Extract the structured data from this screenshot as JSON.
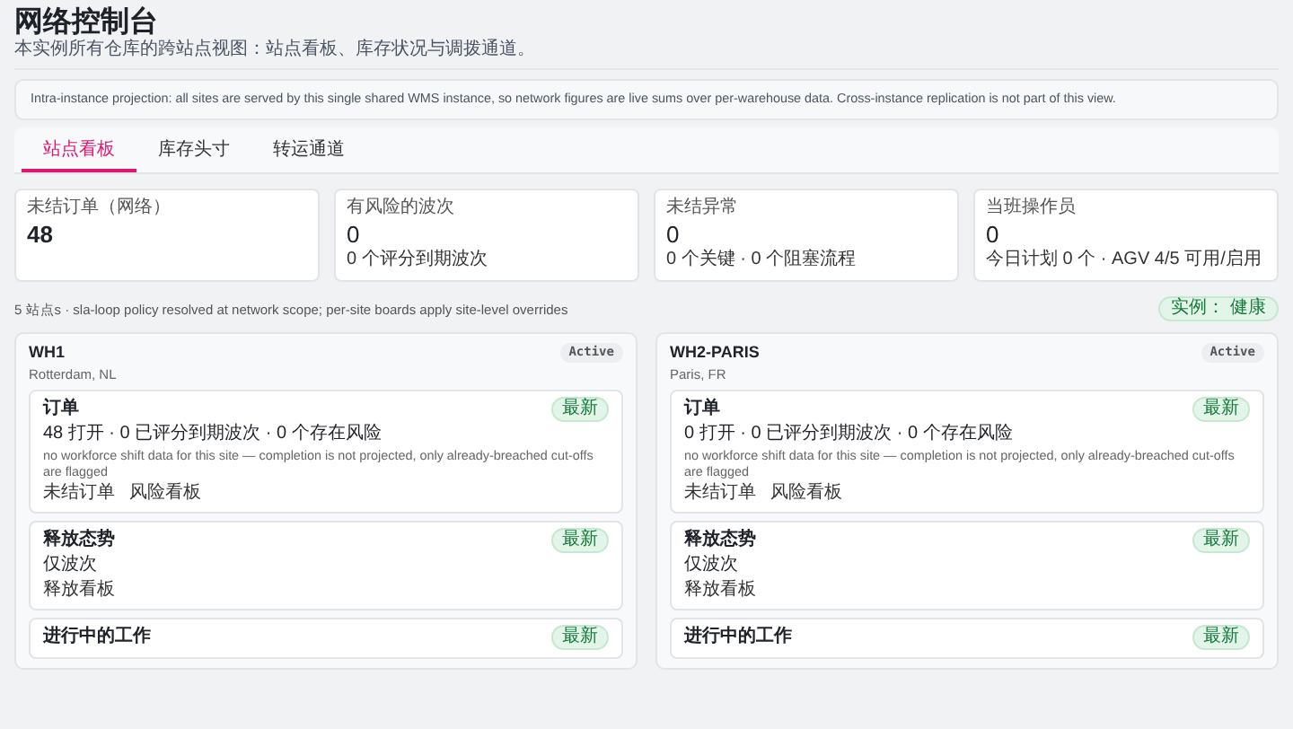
{
  "header": {
    "title": "网络控制台",
    "subtitle": "本实例所有仓库的跨站点视图：站点看板、库存状况与调拨通道。"
  },
  "notice": "Intra-instance projection: all sites are served by this single shared WMS instance, so network figures are live sums over per-warehouse data. Cross-instance replication is not part of this view.",
  "tabs": [
    {
      "label": "站点看板",
      "selected": true
    },
    {
      "label": "库存头寸",
      "selected": false
    },
    {
      "label": "转运通道",
      "selected": false
    }
  ],
  "kpis": [
    {
      "label": "未结订单（网络）",
      "value": "48",
      "emphasis": true
    },
    {
      "label": "有风险的波次",
      "value": "0",
      "detail": "0 个评分到期波次",
      "emphasis": false
    },
    {
      "label": "未结异常",
      "value": "0",
      "detail": "0 个关键 · 0 个阻塞流程",
      "emphasis": false
    },
    {
      "label": "当班操作员",
      "value": "0",
      "detail": "今日计划 0 个 · AGV 4/5 可用/启用",
      "emphasis": false
    }
  ],
  "policy_line": "5 站点s · sla-loop policy resolved at network scope; per-site boards apply site-level overrides",
  "instance_badge": "实例： 健康",
  "sites": [
    {
      "name": "WH1",
      "location": "Rotterdam, NL",
      "status": "Active",
      "sections": [
        {
          "title": "订单",
          "badge": "最新",
          "summary": "48 打开 · 0 已评分到期波次 · 0 个存在风险",
          "note": "no workforce shift data for this site — completion is not projected, only already-breached cut-offs are flagged",
          "links": [
            "未结订单",
            "风险看板"
          ]
        },
        {
          "title": "释放态势",
          "badge": "最新",
          "summary": "仅波次",
          "links": [
            "释放看板"
          ]
        },
        {
          "title": "进行中的工作",
          "badge": "最新"
        }
      ]
    },
    {
      "name": "WH2-PARIS",
      "location": "Paris, FR",
      "status": "Active",
      "sections": [
        {
          "title": "订单",
          "badge": "最新",
          "summary": "0 打开 · 0 已评分到期波次 · 0 个存在风险",
          "note": "no workforce shift data for this site — completion is not projected, only already-breached cut-offs are flagged",
          "links": [
            "未结订单",
            "风险看板"
          ]
        },
        {
          "title": "释放态势",
          "badge": "最新",
          "summary": "仅波次",
          "links": [
            "释放看板"
          ]
        },
        {
          "title": "进行中的工作",
          "badge": "最新"
        }
      ]
    }
  ]
}
